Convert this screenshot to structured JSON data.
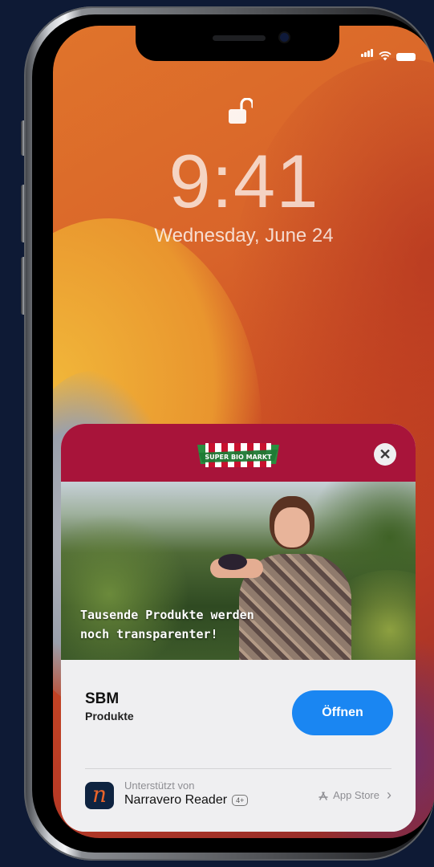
{
  "status_bar": {
    "signal_icon": "signal-icon",
    "wifi_icon": "wifi-icon",
    "battery_icon": "battery-icon"
  },
  "lock_screen": {
    "time": "9:41",
    "date": "Wednesday, June 24",
    "lock_icon": "unlocked-padlock-icon"
  },
  "app_clip": {
    "header_color": "#a8143a",
    "logo_text": "SUPER BIO MARKT",
    "close_icon": "close-icon",
    "banner_text_line1": "Tausende Produkte werden",
    "banner_text_line2": "noch transparenter!",
    "app_name": "SBM",
    "app_subtitle": "Produkte",
    "open_button": "Öffnen",
    "open_button_color": "#1a86f2",
    "supported_by_label": "Unterstützt von",
    "provider_name": "Narravero Reader",
    "age_rating": "4+",
    "provider_icon_letter": "n",
    "store_link": "App Store",
    "store_icon": "app-store-icon",
    "store_chevron": "›"
  }
}
